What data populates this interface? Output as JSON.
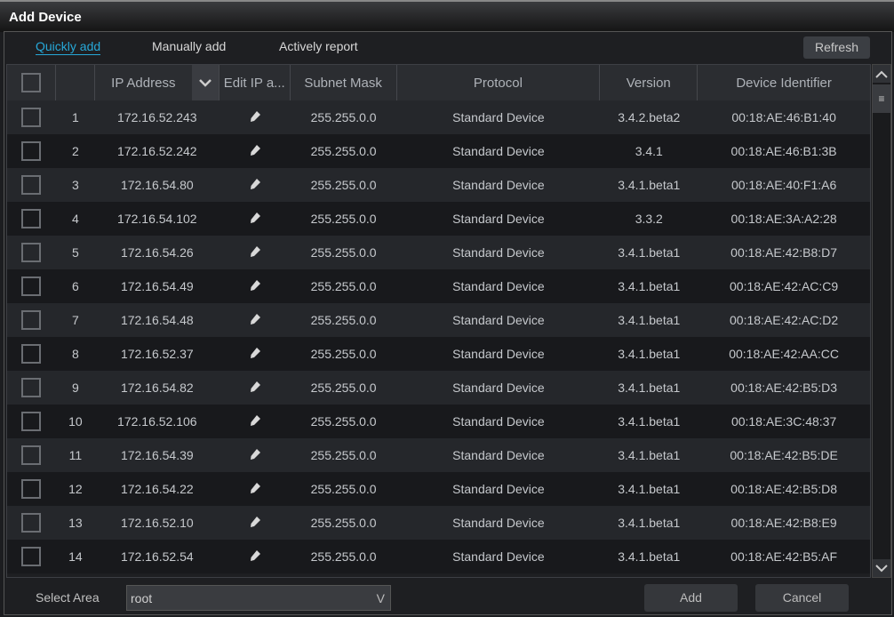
{
  "window": {
    "title": "Add Device"
  },
  "tabs": [
    {
      "label": "Quickly add",
      "active": true
    },
    {
      "label": "Manually add"
    },
    {
      "label": "Actively report"
    }
  ],
  "refresh_label": "Refresh",
  "columns": [
    "IP Address",
    "Edit IP a...",
    "Subnet Mask",
    "Protocol",
    "Version",
    "Device Identifier"
  ],
  "rows": [
    {
      "n": "1",
      "ip": "172.16.52.243",
      "mask": "255.255.0.0",
      "protocol": "Standard Device",
      "version": "3.4.2.beta2",
      "id": "00:18:AE:46:B1:40"
    },
    {
      "n": "2",
      "ip": "172.16.52.242",
      "mask": "255.255.0.0",
      "protocol": "Standard Device",
      "version": "3.4.1",
      "id": "00:18:AE:46:B1:3B"
    },
    {
      "n": "3",
      "ip": "172.16.54.80",
      "mask": "255.255.0.0",
      "protocol": "Standard Device",
      "version": "3.4.1.beta1",
      "id": "00:18:AE:40:F1:A6"
    },
    {
      "n": "4",
      "ip": "172.16.54.102",
      "mask": "255.255.0.0",
      "protocol": "Standard Device",
      "version": "3.3.2",
      "id": "00:18:AE:3A:A2:28"
    },
    {
      "n": "5",
      "ip": "172.16.54.26",
      "mask": "255.255.0.0",
      "protocol": "Standard Device",
      "version": "3.4.1.beta1",
      "id": "00:18:AE:42:B8:D7"
    },
    {
      "n": "6",
      "ip": "172.16.54.49",
      "mask": "255.255.0.0",
      "protocol": "Standard Device",
      "version": "3.4.1.beta1",
      "id": "00:18:AE:42:AC:C9"
    },
    {
      "n": "7",
      "ip": "172.16.54.48",
      "mask": "255.255.0.0",
      "protocol": "Standard Device",
      "version": "3.4.1.beta1",
      "id": "00:18:AE:42:AC:D2"
    },
    {
      "n": "8",
      "ip": "172.16.52.37",
      "mask": "255.255.0.0",
      "protocol": "Standard Device",
      "version": "3.4.1.beta1",
      "id": "00:18:AE:42:AA:CC"
    },
    {
      "n": "9",
      "ip": "172.16.54.82",
      "mask": "255.255.0.0",
      "protocol": "Standard Device",
      "version": "3.4.1.beta1",
      "id": "00:18:AE:42:B5:D3"
    },
    {
      "n": "10",
      "ip": "172.16.52.106",
      "mask": "255.255.0.0",
      "protocol": "Standard Device",
      "version": "3.4.1.beta1",
      "id": "00:18:AE:3C:48:37"
    },
    {
      "n": "11",
      "ip": "172.16.54.39",
      "mask": "255.255.0.0",
      "protocol": "Standard Device",
      "version": "3.4.1.beta1",
      "id": "00:18:AE:42:B5:DE"
    },
    {
      "n": "12",
      "ip": "172.16.54.22",
      "mask": "255.255.0.0",
      "protocol": "Standard Device",
      "version": "3.4.1.beta1",
      "id": "00:18:AE:42:B5:D8"
    },
    {
      "n": "13",
      "ip": "172.16.52.10",
      "mask": "255.255.0.0",
      "protocol": "Standard Device",
      "version": "3.4.1.beta1",
      "id": "00:18:AE:42:B8:E9"
    },
    {
      "n": "14",
      "ip": "172.16.52.54",
      "mask": "255.255.0.0",
      "protocol": "Standard Device",
      "version": "3.4.1.beta1",
      "id": "00:18:AE:42:B5:AF"
    }
  ],
  "footer": {
    "area_label": "Select Area",
    "area_value": "root",
    "add_label": "Add",
    "cancel_label": "Cancel"
  },
  "colors": {
    "accent": "#27a8d8"
  },
  "icons": {
    "edit": "pencil-icon",
    "sort": "chevron-down-icon"
  }
}
